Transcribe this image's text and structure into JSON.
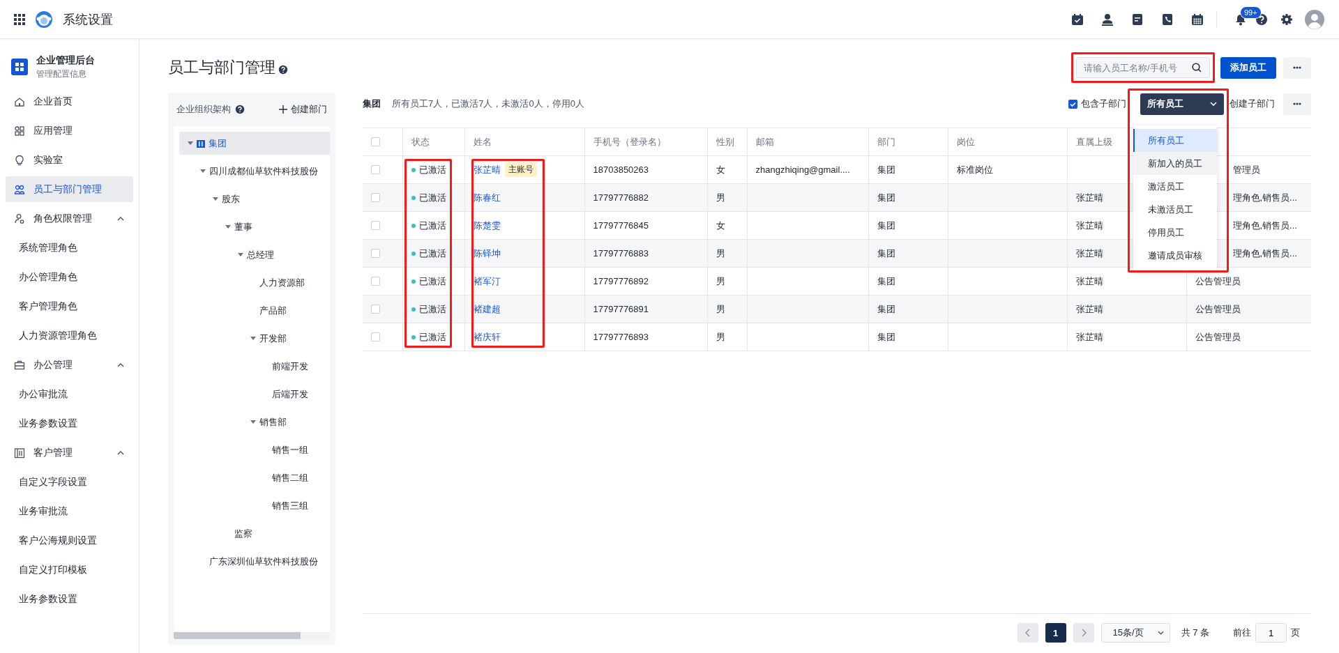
{
  "app": {
    "title": "系统设置",
    "notification_badge": "99+"
  },
  "sidebar": {
    "org_name": "企业管理后台",
    "org_subtitle": "管理配置信息",
    "items": [
      {
        "kind": "link",
        "label": "企业首页",
        "selected": false
      },
      {
        "kind": "link",
        "label": "应用管理",
        "selected": false
      },
      {
        "kind": "link",
        "label": "实验室",
        "selected": false
      },
      {
        "kind": "link",
        "label": "员工与部门管理",
        "selected": true
      },
      {
        "kind": "group",
        "label": "角色权限管理",
        "expanded": true,
        "children": [
          {
            "label": "系统管理角色",
            "selected": false
          },
          {
            "label": "办公管理角色",
            "selected": false
          },
          {
            "label": "客户管理角色",
            "selected": false
          },
          {
            "label": "人力资源管理角色",
            "selected": false
          }
        ]
      },
      {
        "kind": "group",
        "label": "办公管理",
        "expanded": true,
        "children": [
          {
            "label": "办公审批流",
            "selected": false
          },
          {
            "label": "业务参数设置",
            "selected": false
          }
        ]
      },
      {
        "kind": "group",
        "label": "客户管理",
        "expanded": true,
        "children": [
          {
            "label": "自定义字段设置",
            "selected": false
          },
          {
            "label": "业务审批流",
            "selected": false
          },
          {
            "label": "客户公海规则设置",
            "selected": false
          },
          {
            "label": "自定义打印模板",
            "selected": false
          },
          {
            "label": "业务参数设置",
            "selected": false
          }
        ]
      }
    ]
  },
  "page": {
    "title": "员工与部门管理"
  },
  "org_tree": {
    "title": "企业组织架构",
    "create_label": "创建部门",
    "nodes": [
      {
        "label": "集团",
        "selected": true,
        "expanded": true,
        "children": [
          {
            "label": "四川成都仙草软件科技股份",
            "selected": false,
            "expanded": true,
            "children": [
              {
                "label": "股东",
                "selected": false,
                "expanded": true,
                "children": [
                  {
                    "label": "董事",
                    "selected": false,
                    "expanded": true,
                    "children": [
                      {
                        "label": "总经理",
                        "selected": false,
                        "expanded": true,
                        "children": [
                          {
                            "label": "人力资源部",
                            "selected": false
                          },
                          {
                            "label": "产品部",
                            "selected": false
                          },
                          {
                            "label": "开发部",
                            "selected": false,
                            "expanded": true,
                            "children": [
                              {
                                "label": "前端开发",
                                "selected": false
                              },
                              {
                                "label": "后端开发",
                                "selected": false
                              }
                            ]
                          },
                          {
                            "label": "销售部",
                            "selected": false,
                            "expanded": true,
                            "children": [
                              {
                                "label": "销售一组",
                                "selected": false
                              },
                              {
                                "label": "销售二组",
                                "selected": false
                              },
                              {
                                "label": "销售三组",
                                "selected": false
                              }
                            ]
                          }
                        ]
                      }
                    ]
                  },
                  {
                    "label": "监察",
                    "selected": false
                  }
                ]
              }
            ]
          },
          {
            "label": "广东深圳仙草软件科技股份",
            "selected": false
          }
        ]
      }
    ]
  },
  "summary": {
    "group": "集团",
    "text": "所有员工7人，已激活7人，未激活0人，停用0人"
  },
  "toolbar": {
    "search_placeholder": "请输入员工名称/手机号",
    "add_button": "添加员工",
    "include_sub": {
      "label": "包含子部门",
      "checked": true
    },
    "filter": {
      "value": "所有员工",
      "expanded": true,
      "options": [
        {
          "label": "所有员工",
          "selected": true,
          "hovered": false
        },
        {
          "label": "新加入的员工",
          "selected": false,
          "hovered": true
        },
        {
          "label": "激活员工",
          "selected": false,
          "hovered": false
        },
        {
          "label": "未激活员工",
          "selected": false,
          "hovered": false
        },
        {
          "label": "停用员工",
          "selected": false,
          "hovered": false
        },
        {
          "label": "邀请成员审核",
          "selected": false,
          "hovered": false
        }
      ]
    },
    "create_sub": "创建子部门"
  },
  "table": {
    "header_checked": false,
    "columns": [
      "状态",
      "姓名",
      "手机号（登录名）",
      "性别",
      "邮箱",
      "部门",
      "岗位",
      "直属上级"
    ],
    "rows": [
      {
        "checked": false,
        "status": "已激活",
        "name": "张芷晴",
        "tag": "主账号",
        "phone": "18703850263",
        "gender": "女",
        "email": "zhangzhiqing@gmail....",
        "department": "集团",
        "position": "标准岗位",
        "column_10": "管理员",
        "covered": true
      },
      {
        "checked": false,
        "status": "已激活",
        "name": "陈春红",
        "phone": "17797776882",
        "gender": "男",
        "department": "集团",
        "manager": "张芷晴",
        "column_10": "理角色,销售员...",
        "covered": true
      },
      {
        "checked": false,
        "status": "已激活",
        "name": "陈楚雯",
        "phone": "17797776845",
        "gender": "女",
        "department": "集团",
        "manager": "张芷晴",
        "column_10": "理角色,销售员...",
        "covered": true
      },
      {
        "checked": false,
        "status": "已激活",
        "name": "陈铎坤",
        "phone": "17797776883",
        "gender": "男",
        "department": "集团",
        "manager": "张芷晴",
        "column_10": "理角色,销售员...",
        "covered": true
      },
      {
        "checked": false,
        "status": "已激活",
        "name": "褚军汀",
        "phone": "17797776892",
        "gender": "男",
        "department": "集团",
        "manager": "张芷晴",
        "column_10": "公告管理员",
        "covered": false
      },
      {
        "checked": false,
        "status": "已激活",
        "name": "褚建超",
        "phone": "17797776891",
        "gender": "男",
        "department": "集团",
        "manager": "张芷晴",
        "column_10": "公告管理员",
        "covered": false
      },
      {
        "checked": false,
        "status": "已激活",
        "name": "褚庆轩",
        "phone": "17797776893",
        "gender": "男",
        "department": "集团",
        "manager": "张芷晴",
        "column_10": "公告管理员",
        "covered": false
      }
    ]
  },
  "pagination": {
    "current": "1",
    "page_size": "15条/页",
    "total": "共 7 条",
    "goto_label": "前往",
    "goto_value": "1",
    "page_unit": "页"
  }
}
